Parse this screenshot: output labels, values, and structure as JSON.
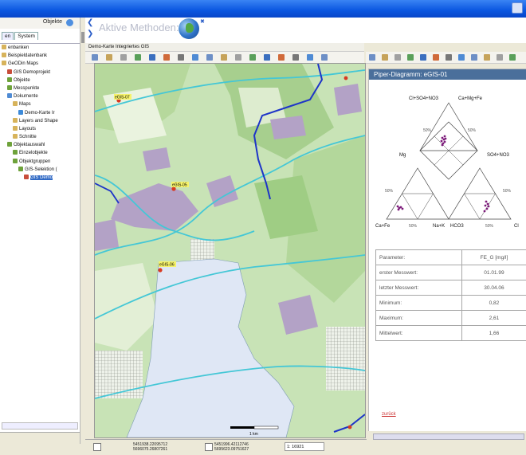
{
  "left_panel": {
    "objects_label": "Objekte",
    "tabs": [
      "en",
      "System"
    ],
    "tree": [
      {
        "label": "enbanken",
        "indent": 0,
        "color": "#d7b35b"
      },
      {
        "label": "Beispieldatenbank",
        "indent": 0,
        "color": "#d7b35b"
      },
      {
        "label": "GeODin Maps",
        "indent": 0,
        "color": "#d7b35b"
      },
      {
        "label": "GIS Demoprojekt",
        "indent": 1,
        "color": "#c84d3a"
      },
      {
        "label": "Objekte",
        "indent": 1,
        "color": "#6ea23a"
      },
      {
        "label": "Messpunkte",
        "indent": 1,
        "color": "#6ea23a"
      },
      {
        "label": "Dokumente",
        "indent": 1,
        "color": "#4f8bd4"
      },
      {
        "label": "Maps",
        "indent": 2,
        "color": "#d7b35b"
      },
      {
        "label": "Demo-Karte Ir",
        "indent": 3,
        "color": "#3d8ad9"
      },
      {
        "label": "Layers and Shape",
        "indent": 2,
        "color": "#d7b35b"
      },
      {
        "label": "Layouts",
        "indent": 2,
        "color": "#d7b35b"
      },
      {
        "label": "Schnitte",
        "indent": 2,
        "color": "#d7b35b"
      },
      {
        "label": "Objektauswahl",
        "indent": 1,
        "color": "#6ea23a"
      },
      {
        "label": "Einzelobjekte",
        "indent": 2,
        "color": "#6ea23a"
      },
      {
        "label": "Objektgruppen",
        "indent": 2,
        "color": "#6ea23a"
      },
      {
        "label": "GIS-Selektion (",
        "indent": 3,
        "color": "#6ea23a"
      },
      {
        "label": "GIS Demo",
        "indent": 4,
        "color": "#c84d3a",
        "selected": true
      }
    ]
  },
  "methods": {
    "label": "Aktive Methoden:"
  },
  "map": {
    "title": "Demo-Karte Integriertes GIS",
    "points": [
      "eGIS-07",
      "eGIS-05",
      "eGIS-06"
    ],
    "scale_label": "1 km"
  },
  "status": {
    "coord1_a": "5451938.22095712",
    "coord1_b": "5696075.26807261",
    "coord2_a": "5451996.42112746",
    "coord2_b": "5695623.09751627",
    "scale": "1: 16921"
  },
  "piper": {
    "title": "Piper-Diagramm: eGIS-01",
    "labels": {
      "top_left": "Cl+SO4+NO3",
      "top_right": "Ca+Mg+Fe",
      "mg": "Mg",
      "so4": "SO4+NO3",
      "cafe": "Ca+Fe",
      "nak": "Na+K",
      "hco3": "HCO3",
      "cl": "Cl",
      "p50": "50%"
    }
  },
  "params": [
    {
      "label": "Parameter:",
      "value": "FE_G [mg/l]"
    },
    {
      "label": "erster Messwert:",
      "value": "01.01.99"
    },
    {
      "label": "letzter Messwert:",
      "value": "30.04.06"
    },
    {
      "label": "Minimum:",
      "value": "0,82"
    },
    {
      "label": "Maximum:",
      "value": "2,61"
    },
    {
      "label": "Mittelwert:",
      "value": "1,66"
    }
  ],
  "back_link": "zurück"
}
